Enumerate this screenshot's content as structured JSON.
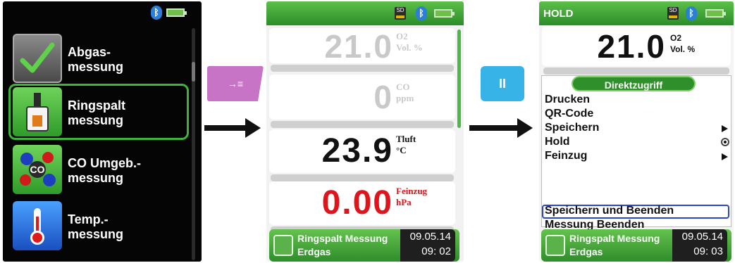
{
  "screen1": {
    "menu_items": [
      {
        "label": "Abgas-\nmessung",
        "icon": "checkmark-icon"
      },
      {
        "label": "Ringspalt\nmessung",
        "icon": "ringspalt-probe-icon"
      },
      {
        "label": "CO Umgeb.-\nmessung",
        "icon": "co-molecule-icon"
      },
      {
        "label": "Temp.-\nmessung",
        "icon": "thermometer-icon"
      }
    ]
  },
  "keys": {
    "store_key_symbol": "→≡",
    "hold_key_symbol": "II"
  },
  "screen2": {
    "readings": [
      {
        "value": "21.0",
        "unit": "O2\nVol. %",
        "color": "#c9c9c9"
      },
      {
        "value": "0",
        "unit": "CO\nppm",
        "color": "#c9c9c9"
      },
      {
        "value": "23.9",
        "unit": "Tluft\n°C",
        "color": "#111111"
      },
      {
        "value": "0.00",
        "unit": "Feinzug\nhPa",
        "color": "#e0141b"
      }
    ],
    "footer": {
      "line1": "Ringspalt Messung",
      "line2": "Erdgas",
      "date": "09.05.14",
      "time": "09: 02"
    },
    "status": {
      "sd": "SD"
    }
  },
  "screen3": {
    "header_title": "HOLD",
    "reading": {
      "value": "21.0",
      "unit": "O2\nVol. %"
    },
    "menu_title": "Direktzugriff",
    "menu_items": [
      "Drucken",
      "QR-Code",
      "Speichern",
      "Hold",
      "Feinzug"
    ],
    "bottom_items": [
      "Speichern und Beenden",
      "Messung Beenden"
    ],
    "footer": {
      "line1": "Ringspalt Messung",
      "line2": "Erdgas",
      "date": "09.05.14",
      "time": "09: 03"
    },
    "status": {
      "sd": "SD"
    }
  }
}
